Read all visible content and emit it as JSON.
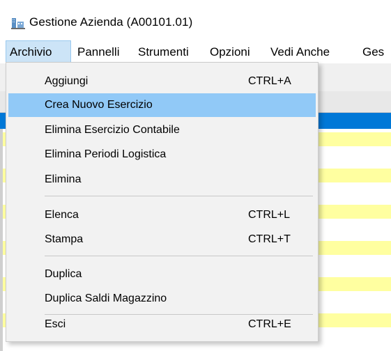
{
  "window": {
    "title": "Gestione Azienda   (A00101.01)"
  },
  "menubar": {
    "items": [
      {
        "label": "Archivio"
      },
      {
        "label": "Pannelli"
      },
      {
        "label": "Strumenti"
      },
      {
        "label": "Opzioni"
      },
      {
        "label": "Vedi Anche"
      },
      {
        "label": "Ges"
      }
    ]
  },
  "dropdown": {
    "items": [
      {
        "label": "Aggiungi",
        "shortcut": "CTRL+A"
      },
      {
        "label": "Crea Nuovo Esercizio",
        "shortcut": ""
      },
      {
        "label": "Elimina Esercizio Contabile",
        "shortcut": ""
      },
      {
        "label": "Elimina Periodi Logistica",
        "shortcut": ""
      },
      {
        "label": "Elimina",
        "shortcut": ""
      },
      {
        "label": "Elenca",
        "shortcut": "CTRL+L"
      },
      {
        "label": "Stampa",
        "shortcut": "CTRL+T"
      },
      {
        "label": "Duplica",
        "shortcut": ""
      },
      {
        "label": "Duplica Saldi Magazzino",
        "shortcut": ""
      },
      {
        "label": "Esci",
        "shortcut": "CTRL+E"
      }
    ]
  },
  "colors": {
    "menu_hover": "#91c9f7",
    "menu_active": "#cce4f7",
    "grid_selected": "#0078d7",
    "grid_yellow": "#ffffa0"
  }
}
